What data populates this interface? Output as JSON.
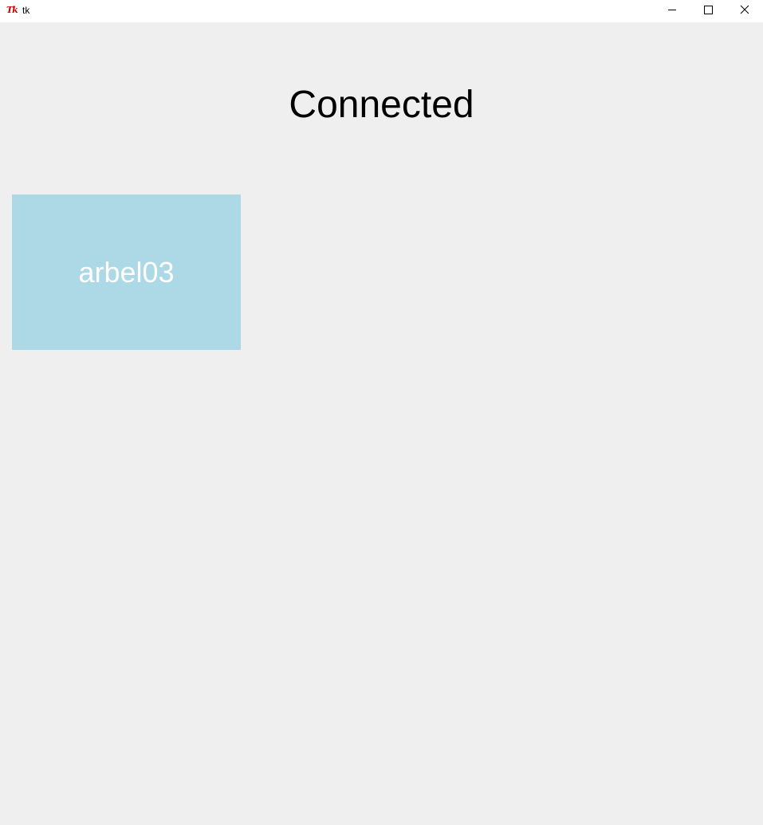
{
  "window": {
    "title": "tk",
    "icon": "tk-feather-icon",
    "controls": {
      "minimize_icon": "minimize-icon",
      "maximize_icon": "maximize-icon",
      "close_icon": "close-icon"
    }
  },
  "main": {
    "status_title": "Connected",
    "clients": [
      {
        "label": "arbel03",
        "color": "#add8e6"
      }
    ]
  },
  "colors": {
    "background": "#efefef",
    "titlebar": "#ffffff",
    "tile": "#add8e6",
    "tile_text": "#ffffff",
    "text": "#000000"
  }
}
